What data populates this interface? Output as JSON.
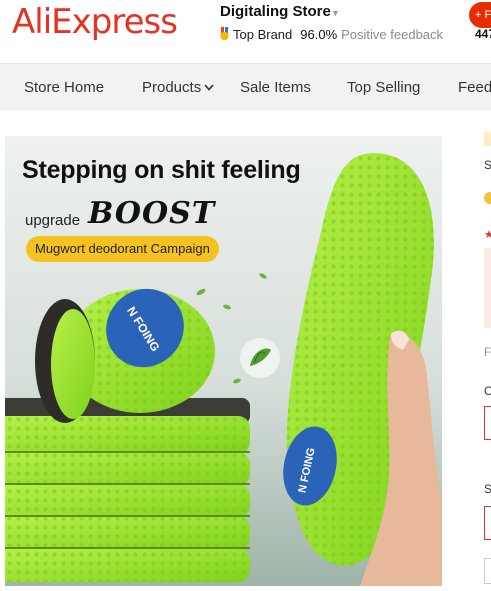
{
  "header": {
    "logo_text": "AliExpress",
    "store_name": "Digitaling Store",
    "badge_label": "Top Brand",
    "rating": "96.0%",
    "feedback_label": "Positive feedback",
    "follow_label": "+ F",
    "followers": "447"
  },
  "nav": {
    "items": [
      {
        "label": "Store Home"
      },
      {
        "label": "Products"
      },
      {
        "label": "Sale Items"
      },
      {
        "label": "Top Selling"
      },
      {
        "label": "Feed"
      }
    ]
  },
  "product_image": {
    "headline": "Stepping on shit feeling",
    "upgrade_text": "upgrade",
    "boost_text": "BOOST",
    "campaign_text": "Mugwort deodorant Campaign",
    "brand_mark": "N FOING"
  },
  "right_column": {
    "fragments": [
      "S",
      "F",
      "C",
      "S"
    ]
  },
  "colors": {
    "brand": "#e43225",
    "insole_green": "#9ae62a",
    "campaign_yellow": "#f6c221",
    "logo_blue": "#2a63b8"
  }
}
